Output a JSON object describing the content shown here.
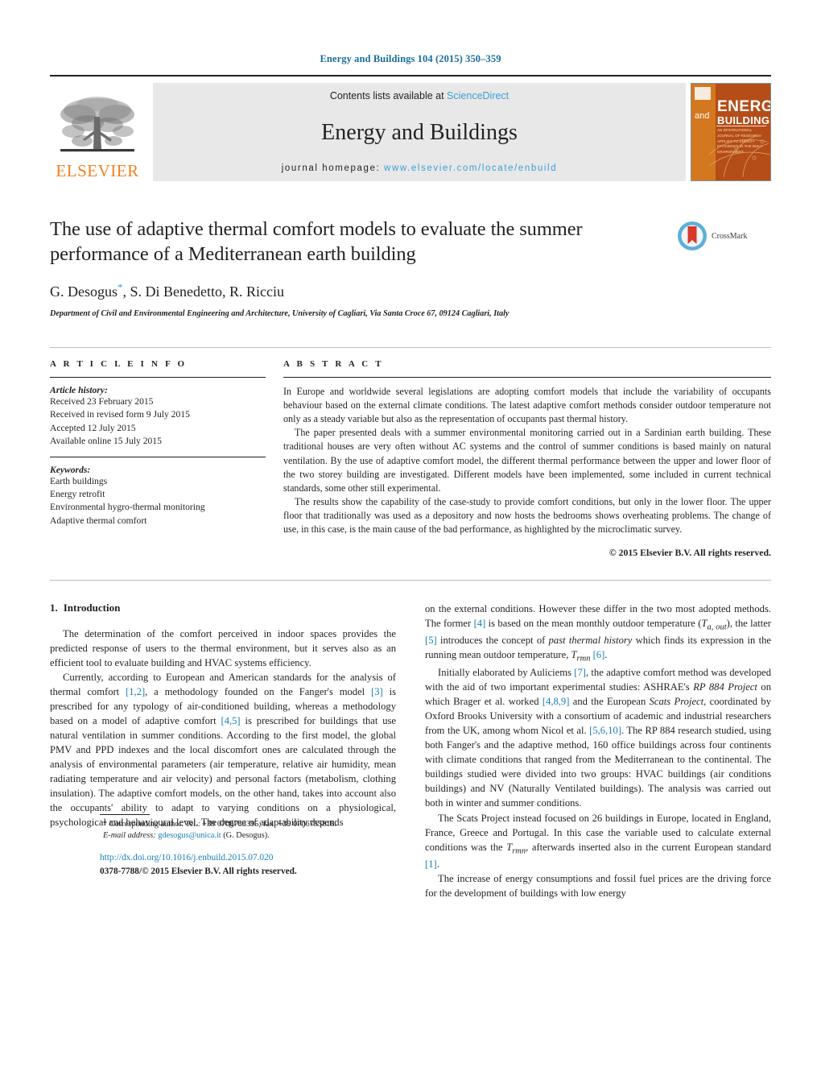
{
  "running_head": "Energy and Buildings 104 (2015) 350–359",
  "masthead": {
    "elsevier_wordmark": "ELSEVIER",
    "contents_prefix": "Contents lists available at ",
    "sciencedirect": "ScienceDirect",
    "journal_title": "Energy and Buildings",
    "homepage_prefix": "journal homepage: ",
    "homepage_url": "www.elsevier.com/locate/enbuild",
    "cover": {
      "and": "and",
      "energy": "ENERGY",
      "buildings": "BUILDINGS",
      "subtitle": "AN INTERNATIONAL JOURNAL OF RESEARCH APPLIED TO ENERGY EFFICIENCY IN THE BUILT ENVIRONMENT"
    },
    "accent_blue": "#3b9fd4",
    "elsevier_orange": "#f08221"
  },
  "article": {
    "title": "The use of adaptive thermal comfort models to evaluate the summer performance of a Mediterranean earth building",
    "authors": "G. Desogus",
    "authors_rest": ", S. Di Benedetto, R. Ricciu",
    "affiliation": "Department of Civil and Environmental Engineering and Architecture, University of Cagliari, Via Santa Croce 67, 09124 Cagliari, Italy",
    "crossmark_label": "CrossMark"
  },
  "info": {
    "heading": "A R T I C L E   I N F O",
    "history_label": "Article history:",
    "history": [
      "Received 23 February 2015",
      "Received in revised form 9 July 2015",
      "Accepted 12 July 2015",
      "Available online 15 July 2015"
    ],
    "keywords_label": "Keywords:",
    "keywords": [
      "Earth buildings",
      "Energy retrofit",
      "Environmental hygro-thermal monitoring",
      "Adaptive thermal comfort"
    ]
  },
  "abstract": {
    "heading": "A B S T R A C T",
    "paragraphs": [
      "In Europe and worldwide several legislations are adopting comfort models that include the variability of occupants behaviour based on the external climate conditions. The latest adaptive comfort methods consider outdoor temperature not only as a steady variable but also as the representation of occupants past thermal history.",
      "The paper presented deals with a summer environmental monitoring carried out in a Sardinian earth building. These traditional houses are very often without AC systems and the control of summer conditions is based mainly on natural ventilation. By the use of adaptive comfort model, the different thermal performance between the upper and lower floor of the two storey building are investigated. Different models have been implemented, some included in current technical standards, some other still experimental.",
      "The results show the capability of the case-study to provide comfort conditions, but only in the lower floor. The upper floor that traditionally was used as a depository and now hosts the bedrooms shows overheating problems. The change of use, in this case, is the main cause of the bad performance, as highlighted by the microclimatic survey."
    ],
    "copyright": "© 2015 Elsevier B.V. All rights reserved."
  },
  "introduction": {
    "number": "1.",
    "title": "Introduction",
    "left_paragraphs": [
      "The determination of the comfort perceived in indoor spaces provides the predicted response of users to the thermal environment, but it serves also as an efficient tool to evaluate building and HVAC systems efficiency."
    ],
    "p2_a": "Currently, according to European and American standards for the analysis of thermal comfort ",
    "p2_ref1": "[1,2]",
    "p2_b": ", a methodology founded on the Fanger's model ",
    "p2_ref2": "[3]",
    "p2_c": " is prescribed for any typology of air-conditioned building, whereas a methodology based on a model of adaptive comfort ",
    "p2_ref3": "[4,5]",
    "p2_d": " is prescribed for buildings that use natural ventilation in summer conditions. According to the first model, the global PMV and PPD indexes and the local discomfort ones are calculated through the analysis of environmental parameters (air temperature, relative air humidity, mean radiating temperature and air velocity) and personal factors (metabolism, clothing insulation). The adaptive comfort models, on the other hand, takes into account also the occupants' ability to adapt to varying conditions on a physiological, psychological and behavioural level. The degree of adaptability depends",
    "r1_a": "on the external conditions. However these differ in the two most adopted methods. The former ",
    "r1_ref1": "[4]",
    "r1_b": " is based on the mean monthly outdoor temperature (",
    "r1_var1": "T",
    "r1_var1sub": "a, out",
    "r1_c": "), the latter ",
    "r1_ref2": "[5]",
    "r1_d": " introduces the concept of ",
    "r1_ital": "past thermal history",
    "r1_e": " which finds its expression in the running mean outdoor temperature, ",
    "r1_var2": "T",
    "r1_var2sub": "rmn",
    "r1_f": " ",
    "r1_ref3": "[6]",
    "r1_g": ".",
    "r2_a": "Initially elaborated by Auliciems ",
    "r2_ref1": "[7]",
    "r2_b": ", the adaptive comfort method was developed with the aid of two important experimental studies: ASHRAE's ",
    "r2_ital1": "RP 884 Project",
    "r2_c": " on which Brager et al. worked ",
    "r2_ref2": "[4,8,9]",
    "r2_d": " and the European ",
    "r2_ital2": "Scats Project",
    "r2_e": ", coordinated by Oxford Brooks University with a consortium of academic and industrial researchers from the UK, among whom Nicol et al. ",
    "r2_ref3": "[5,6,10]",
    "r2_f": ". The RP 884 research studied, using both Fanger's and the adaptive method, 160 office buildings across four continents with climate conditions that ranged from the Mediterranean to the continental. The buildings studied were divided into two groups: HVAC buildings (air conditions buildings) and NV (Naturally Ventilated buildings). The analysis was carried out both in winter and summer conditions.",
    "r3_a": "The Scats Project instead focused on 26 buildings in Europe, located in England, France, Greece and Portugal. In this case the variable used to calculate external conditions was the ",
    "r3_var": "T",
    "r3_varsub": "rmn",
    "r3_b": ", afterwards inserted also in the current European standard ",
    "r3_ref": "[1]",
    "r3_c": ".",
    "r4": "The increase of energy consumptions and fossil fuel prices are the driving force for the development of buildings with low energy"
  },
  "footnote": {
    "star": "*",
    "corresponding": " Corresponding author. Tel.: +39 0706755395; fax: +39 0706755818.",
    "email_label": "E-mail address:",
    "email": "gdesogus@unica.it",
    "email_suffix": " (G. Desogus).",
    "doi": "http://dx.doi.org/10.1016/j.enbuild.2015.07.020",
    "issn": "0378-7788/© 2015 Elsevier B.V. All rights reserved."
  }
}
